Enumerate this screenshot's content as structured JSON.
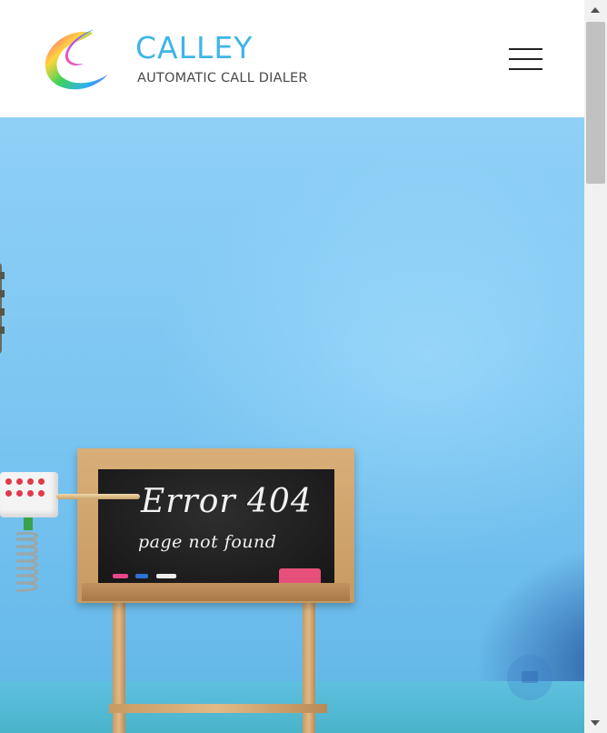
{
  "header": {
    "brand_name": "CALLEY",
    "brand_tagline": "AUTOMATIC CALL DIALER",
    "menu_icon": "hamburger-menu-icon"
  },
  "hero": {
    "board_title": "Error 404",
    "board_subtitle": "page not found"
  },
  "chat_widget": {
    "icon": "chat-icon"
  },
  "colors": {
    "brand_blue": "#3fb5e9",
    "tagline_gray": "#4a4a4a",
    "hero_sky": "#7cc6f2"
  }
}
